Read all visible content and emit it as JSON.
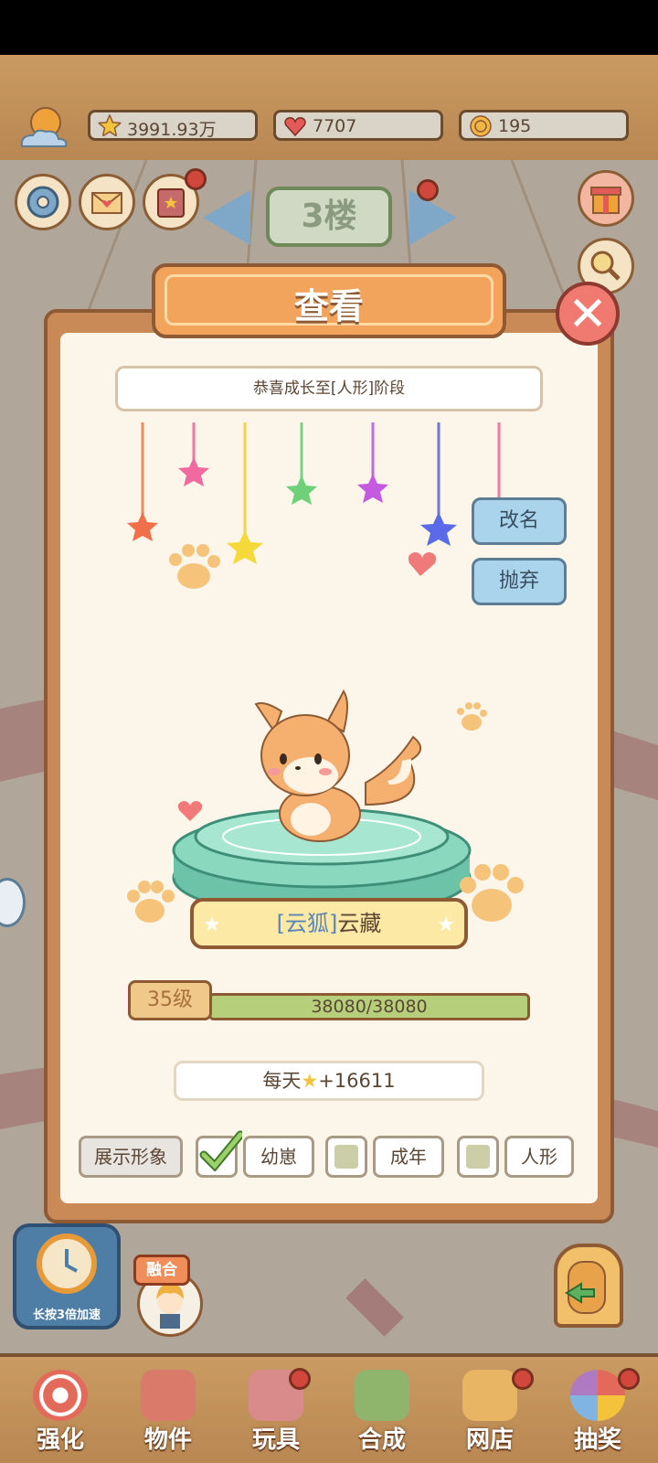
{
  "resources": {
    "stars": "3991.93万",
    "hearts": "7707",
    "coins": "195"
  },
  "floor": {
    "label": "3楼"
  },
  "dialog": {
    "title": "查看",
    "banner": "恭喜成长至[人形]阶段",
    "rename_label": "改名",
    "abandon_label": "抛弃",
    "pet_name_species": "[云狐]",
    "pet_name": "云藏",
    "level_label": "35级",
    "xp_text": "38080/38080",
    "xp_fraction": 1.0,
    "income_prefix": "每天",
    "income_value": "+16611",
    "display_label": "展示形象",
    "stages": [
      {
        "label": "幼崽",
        "checked": true
      },
      {
        "label": "成年",
        "checked": false
      },
      {
        "label": "人形",
        "checked": false
      }
    ]
  },
  "speed_button_label": "长按3倍加速",
  "merge_tag": "融合",
  "bottom_nav": [
    {
      "label": "强化",
      "icon": "lollipop-icon",
      "color": "#e36a5a"
    },
    {
      "label": "物件",
      "icon": "piano-icon",
      "color": "#d97a6a"
    },
    {
      "label": "玩具",
      "icon": "house-toy-icon",
      "color": "#d98a8a"
    },
    {
      "label": "合成",
      "icon": "cards-icon",
      "color": "#8fb56d"
    },
    {
      "label": "网店",
      "icon": "basket-icon",
      "color": "#e7b564"
    },
    {
      "label": "抽奖",
      "icon": "wheel-icon",
      "color": "#b07ac2"
    }
  ],
  "colors": {
    "wood": "#c99b62",
    "dialog_cream": "#fcf5ea",
    "button_blue": "#a9d4ec",
    "title_orange": "#f2a45d"
  }
}
